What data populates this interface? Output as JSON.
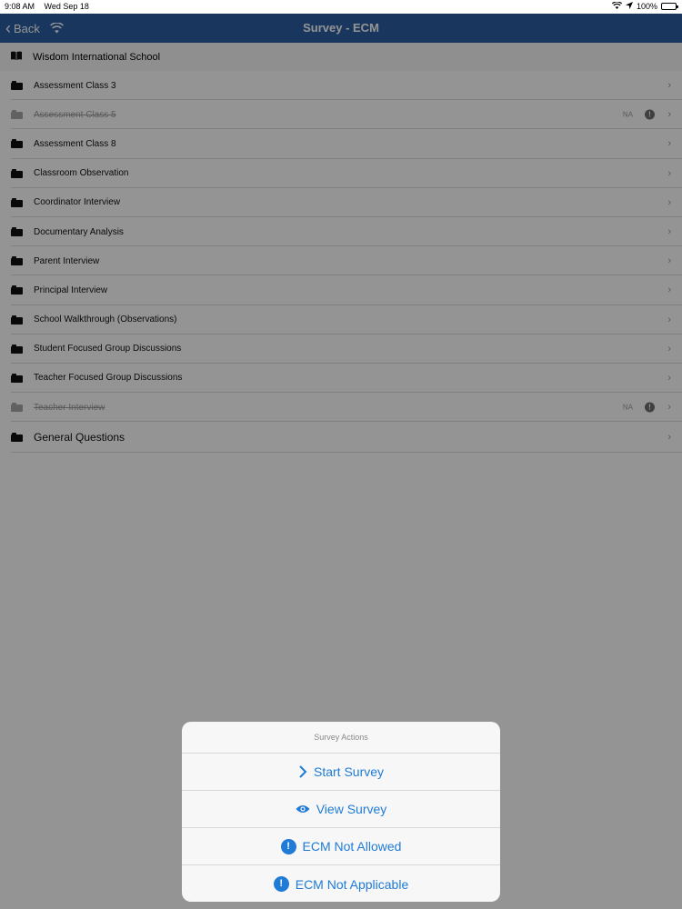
{
  "status_bar": {
    "time": "9:08 AM",
    "date": "Wed Sep 18",
    "battery": "100%"
  },
  "nav": {
    "back_label": "Back",
    "title": "Survey - ECM"
  },
  "school": {
    "name": "Wisdom International School"
  },
  "rows": [
    {
      "label": "Assessment Class 3",
      "disabled": false
    },
    {
      "label": "Assessment Class 5",
      "disabled": true,
      "badge": "NA"
    },
    {
      "label": "Assessment Class 8",
      "disabled": false
    },
    {
      "label": "Classroom Observation",
      "disabled": false
    },
    {
      "label": "Coordinator Interview",
      "disabled": false
    },
    {
      "label": "Documentary Analysis",
      "disabled": false
    },
    {
      "label": "Parent Interview",
      "disabled": false
    },
    {
      "label": "Principal Interview",
      "disabled": false
    },
    {
      "label": "School Walkthrough (Observations)",
      "disabled": false
    },
    {
      "label": "Student Focused Group Discussions",
      "disabled": false
    },
    {
      "label": "Teacher Focused Group Discussions",
      "disabled": false
    },
    {
      "label": "Teacher Interview",
      "disabled": true,
      "badge": "NA"
    },
    {
      "label": "General Questions",
      "disabled": false
    }
  ],
  "action_sheet": {
    "title": "Survey Actions",
    "actions": [
      {
        "label": "Start Survey",
        "icon": "chevron-right-icon"
      },
      {
        "label": "View Survey",
        "icon": "eye-icon"
      },
      {
        "label": "ECM Not Allowed",
        "icon": "alert-icon"
      },
      {
        "label": "ECM Not Applicable",
        "icon": "alert-icon"
      }
    ]
  },
  "colors": {
    "nav": "#2c5fa3",
    "accent": "#1f7bd6"
  }
}
